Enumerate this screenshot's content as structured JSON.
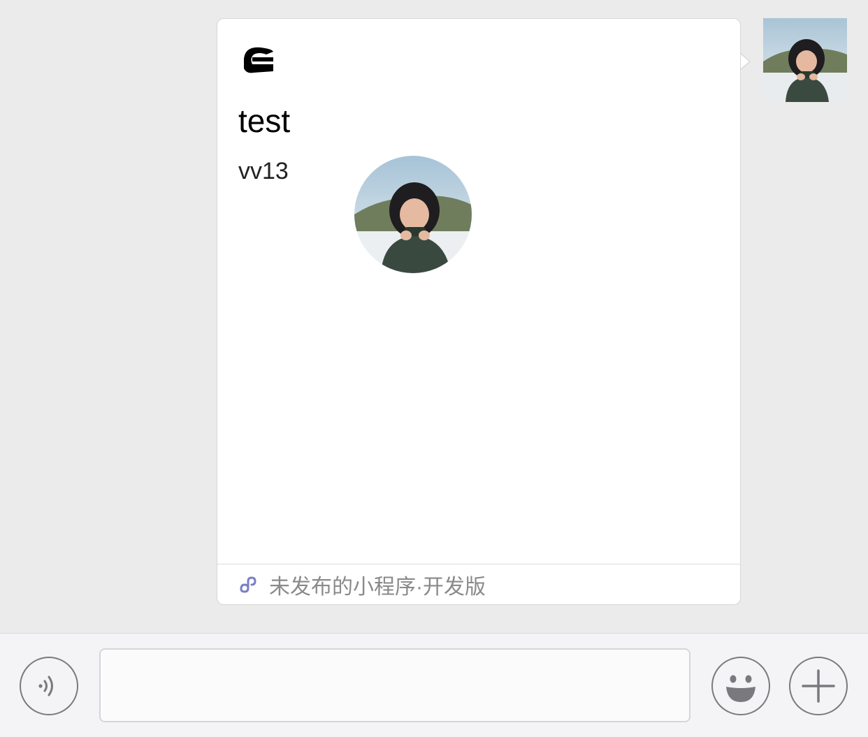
{
  "chat": {
    "sender_avatar_icon": "child-photo-avatar"
  },
  "card": {
    "header_logo_icon": "miniprogram-logo-redacted",
    "title": "test",
    "text": "vv13",
    "avatar_icon": "child-photo-circle",
    "footer_icon": "miniprogram-link-icon",
    "footer_label": "未发布的小程序·开发版",
    "footer_icon_color": "#7b7fc4"
  },
  "input_bar": {
    "voice_icon": "voice-icon",
    "message_value": "",
    "emoji_icon": "emoji-icon",
    "plus_icon": "plus-icon"
  },
  "colors": {
    "chat_background": "#ebebeb",
    "bubble_background": "#ffffff",
    "input_bar_background": "#f4f4f6"
  }
}
